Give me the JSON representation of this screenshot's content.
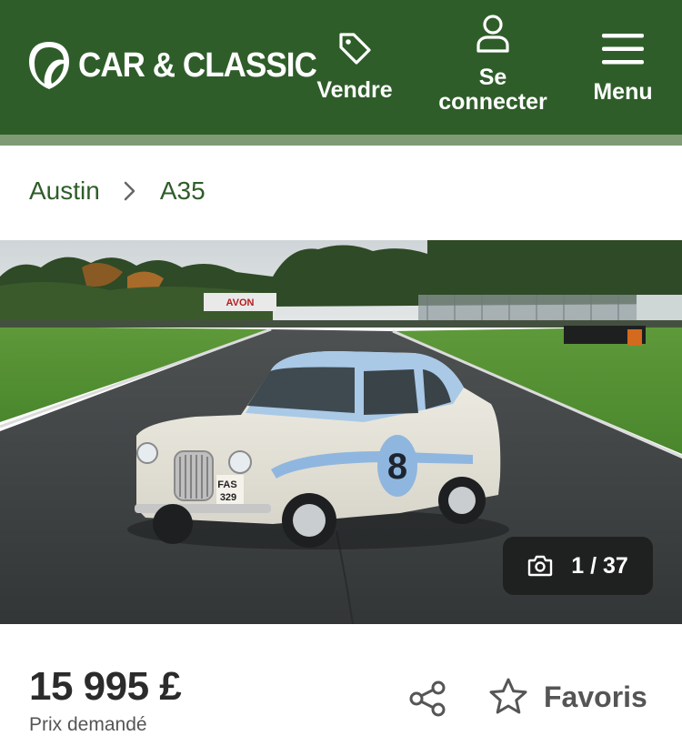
{
  "header": {
    "brand": "CAR & CLASSIC",
    "sell_label": "Vendre",
    "login_label": "Se connecter",
    "menu_label": "Menu",
    "background": "#2f5d2a"
  },
  "breadcrumb": {
    "items": [
      "Austin",
      "A35"
    ]
  },
  "gallery": {
    "counter": "1 / 37",
    "signage": "AVON",
    "plate": [
      "FAS",
      "329"
    ],
    "race_number": "8"
  },
  "listing": {
    "price": "15 995 £",
    "price_label": "Prix demandé",
    "favorites_label": "Favoris"
  },
  "icons": {
    "logo": "car-classic-logo-icon",
    "sell": "tag-icon",
    "login": "user-icon",
    "menu": "hamburger-icon",
    "breadcrumb_separator": "chevron-right-icon",
    "counter": "camera-icon",
    "share": "share-icon",
    "favorites": "star-icon"
  }
}
